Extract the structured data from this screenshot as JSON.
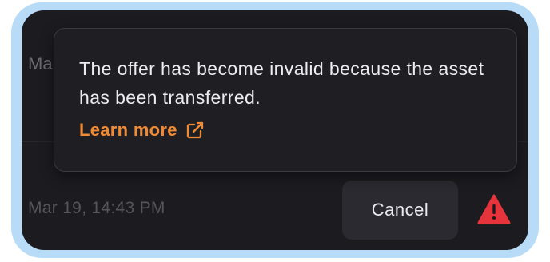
{
  "background_row": {
    "partial_text": "Ma",
    "timestamp": "Mar 19, 14:43 PM"
  },
  "actions": {
    "cancel_label": "Cancel",
    "warning_icon": "warning-triangle-icon"
  },
  "tooltip": {
    "message": "The offer has become invalid because the asset has been transferred.",
    "link_label": "Learn more",
    "link_icon": "external-link-icon"
  },
  "colors": {
    "accent": "#f08a35",
    "warning": "#e5343c",
    "panel_bg": "#1c1c20",
    "frame": "#b8dcf8"
  }
}
